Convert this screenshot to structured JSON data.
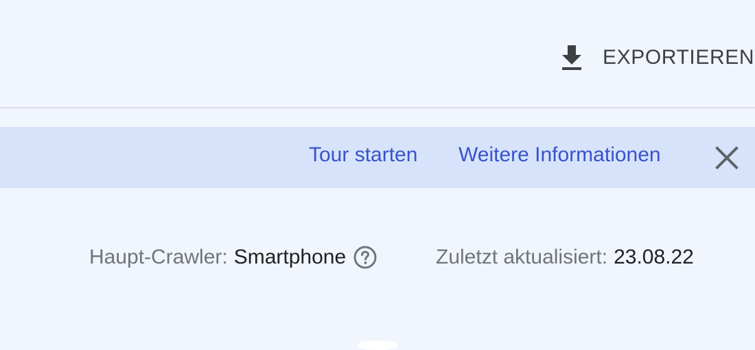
{
  "toolbar": {
    "export_label": "EXPORTIEREN",
    "export_icon": "download-icon"
  },
  "banner": {
    "tour_label": "Tour starten",
    "info_label": "Weitere Informationen",
    "close_icon": "close-icon",
    "background": "#d6e3fb",
    "link_color": "#3853c9"
  },
  "meta": {
    "crawler_label": "Haupt-Crawler:",
    "crawler_value": "Smartphone",
    "help_icon": "help-circle-icon",
    "updated_label": "Zuletzt aktualisiert:",
    "updated_value": "23.08.22"
  },
  "colors": {
    "page_background": "#f1f5fd",
    "label_gray": "#70757a",
    "text_dark": "#202124"
  }
}
